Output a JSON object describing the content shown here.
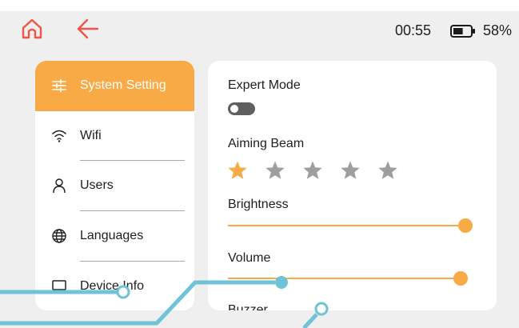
{
  "status_bar": {
    "time": "00:55",
    "battery_percent_label": "58%",
    "battery_level": 0.58,
    "accent_color": "#f0544a"
  },
  "sidebar": {
    "accent_color": "#f7aa45",
    "items": [
      {
        "label": "System Setting",
        "icon": "sliders-icon",
        "active": true
      },
      {
        "label": "Wifi",
        "icon": "wifi-icon",
        "active": false
      },
      {
        "label": "Users",
        "icon": "user-icon",
        "active": false
      },
      {
        "label": "Languages",
        "icon": "globe-icon",
        "active": false
      },
      {
        "label": "Device Info",
        "icon": "monitor-icon",
        "active": false
      }
    ]
  },
  "settings": {
    "expert_mode": {
      "label": "Expert Mode",
      "enabled": false
    },
    "aiming_beam": {
      "label": "Aiming Beam",
      "rating": 1,
      "max": 5
    },
    "brightness": {
      "label": "Brightness",
      "level": 0.97
    },
    "volume": {
      "label": "Volume",
      "level": 0.95
    },
    "buzzer": {
      "label": "Buzzer"
    }
  },
  "overlay_color": "#6ec3d6"
}
